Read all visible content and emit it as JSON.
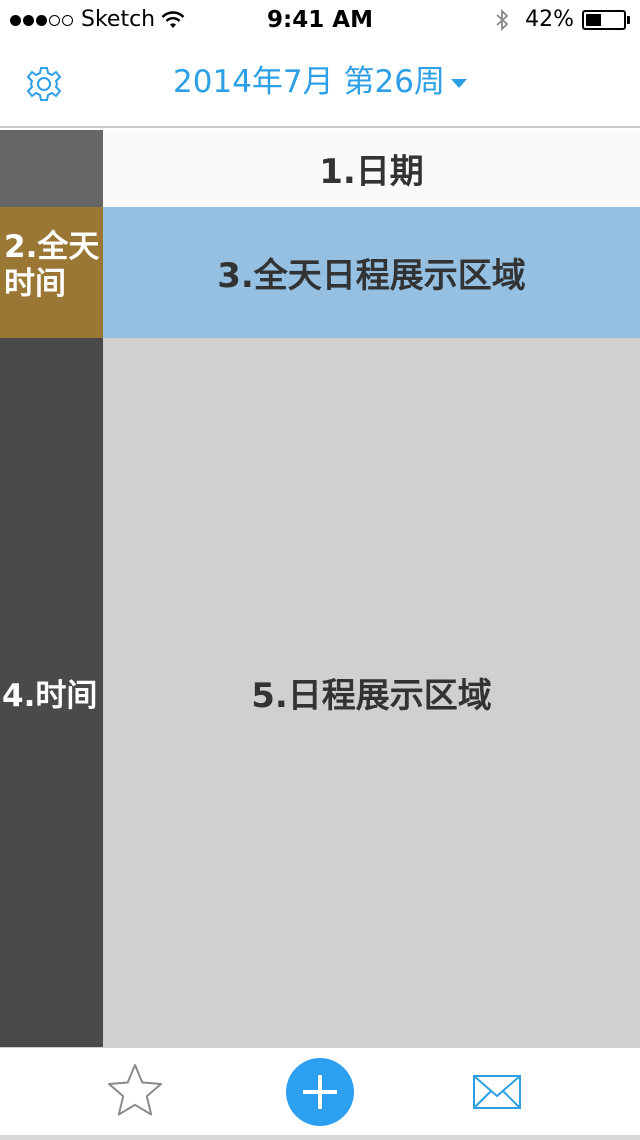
{
  "status_bar": {
    "carrier": "Sketch",
    "time": "9:41 AM",
    "battery_text": "42%",
    "battery_level": 0.42,
    "signal_bars_filled": 3,
    "signal_bars_total": 5,
    "icons": [
      "wifi-icon",
      "bluetooth-icon",
      "battery-icon"
    ]
  },
  "nav": {
    "title": "2014年7月 第26周",
    "settings_icon": "gear-icon",
    "dropdown_icon": "caret-down-icon",
    "accent_color": "#2d9fe6"
  },
  "calendar": {
    "date_header": "1.日期",
    "allday_label": "2.全天\n时间",
    "allday_area": "3.全天日程展示区域",
    "time_label": "4.时间",
    "schedule_area": "5.日程展示区域"
  },
  "colors": {
    "corner": "#666666",
    "allday_label_bg": "#9b7735",
    "allday_area_bg": "#95c0e1",
    "time_column_bg": "#4a4a4a",
    "schedule_area_bg": "#d0d0d0",
    "add_button": "#2d9ff0"
  },
  "tab_bar": {
    "items": [
      {
        "icon": "star-icon"
      },
      {
        "icon": "add-icon"
      },
      {
        "icon": "mail-icon"
      }
    ]
  }
}
